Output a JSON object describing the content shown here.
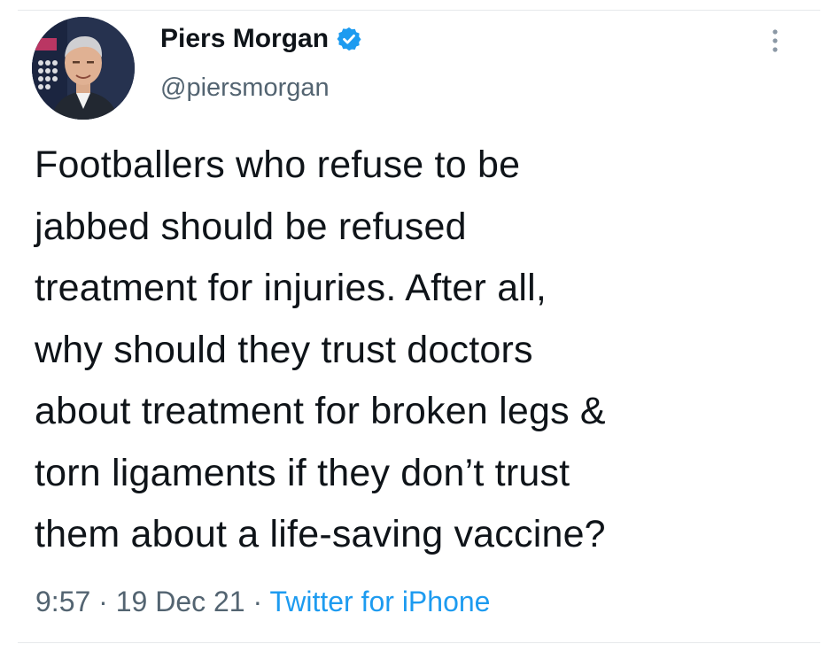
{
  "author": {
    "display_name": "Piers Morgan",
    "handle": "@piersmorgan",
    "verified": true,
    "verified_icon": "verified-badge-icon",
    "avatar_icon": "avatar-photo"
  },
  "menu": {
    "icon": "more-vertical-icon"
  },
  "tweet": {
    "text": "Footballers who refuse to be\njabbed should be refused\ntreatment for injuries. After all,\nwhy should they trust doctors\nabout treatment for broken legs &\ntorn ligaments if they don’t trust\nthem about a life-saving vaccine?"
  },
  "meta": {
    "time": "9:57",
    "separator": " · ",
    "date": "19 Dec 21",
    "source": "Twitter for iPhone"
  },
  "colors": {
    "text_primary": "#0f1419",
    "text_secondary": "#536471",
    "accent": "#1d9bf0",
    "divider": "#e6e9eb"
  }
}
